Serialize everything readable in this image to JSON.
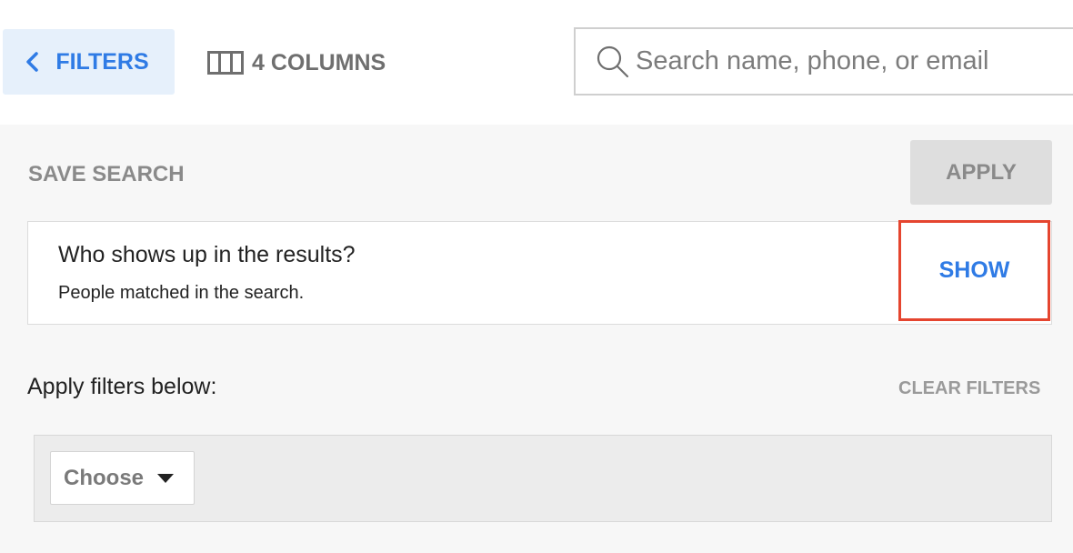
{
  "toolbar": {
    "filters_label": "FILTERS",
    "columns_label": "4 COLUMNS",
    "search_placeholder": "Search name, phone, or email"
  },
  "panel": {
    "save_search_label": "SAVE SEARCH",
    "apply_label": "APPLY",
    "info": {
      "title": "Who shows up in the results?",
      "subtitle": "People matched in the search.",
      "show_label": "SHOW"
    },
    "apply_filters_label": "Apply filters below:",
    "clear_filters_label": "CLEAR FILTERS",
    "filter_select": {
      "selected": "Choose"
    }
  },
  "colors": {
    "accent": "#2f7be5",
    "highlight_border": "#e5452f",
    "filters_bg": "#e6f0fb",
    "panel_bg": "#f7f7f7"
  },
  "icons": {
    "back": "chevron-left-icon",
    "columns": "columns-icon",
    "search": "search-icon",
    "dropdown": "caret-down-icon"
  }
}
